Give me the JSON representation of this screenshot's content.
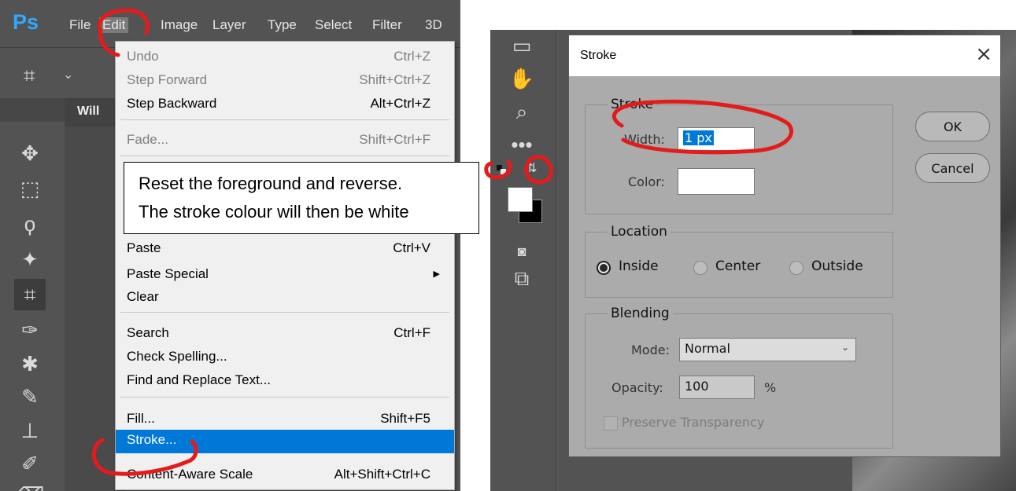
{
  "left_panel": {
    "app_logo": "Ps",
    "menubar": [
      "File",
      "Edit",
      "Image",
      "Layer",
      "Type",
      "Select",
      "Filter",
      "3D"
    ],
    "doc_tab": "Will",
    "edit_menu": {
      "items": [
        {
          "label": "Undo",
          "shortcut": "Ctrl+Z",
          "disabled": true
        },
        {
          "label": "Step Forward",
          "shortcut": "Shift+Ctrl+Z",
          "disabled": true
        },
        {
          "label": "Step Backward",
          "shortcut": "Alt+Ctrl+Z",
          "disabled": false
        },
        {
          "label": "Fade...",
          "shortcut": "Shift+Ctrl+F",
          "disabled": true
        },
        {
          "label": "Paste",
          "shortcut": "Ctrl+V",
          "disabled": false
        },
        {
          "label": "Paste Special",
          "shortcut": "",
          "disabled": false
        },
        {
          "label": "Clear",
          "shortcut": "",
          "disabled": false
        },
        {
          "label": "Search",
          "shortcut": "Ctrl+F",
          "disabled": false
        },
        {
          "label": "Check Spelling...",
          "shortcut": "",
          "disabled": false
        },
        {
          "label": "Find and Replace Text...",
          "shortcut": "",
          "disabled": false
        },
        {
          "label": "Fill...",
          "shortcut": "Shift+F5",
          "disabled": false
        },
        {
          "label": "Stroke...",
          "shortcut": "",
          "disabled": false
        },
        {
          "label": "Content-Aware Scale",
          "shortcut": "Alt+Shift+Ctrl+C",
          "disabled": false
        }
      ]
    },
    "callout": {
      "line1": "Reset the foreground and reverse.",
      "line2": "The stroke colour will then be white"
    }
  },
  "stroke_dialog": {
    "title": "Stroke",
    "close_glyph": "×",
    "stroke_group": {
      "legend": "Stroke",
      "width_label": "Width:",
      "width_value": "1 px",
      "color_label": "Color:",
      "color_value": "#ffffff"
    },
    "location_group": {
      "legend": "Location",
      "options": [
        "Inside",
        "Center",
        "Outside"
      ],
      "selected": "Inside"
    },
    "blending_group": {
      "legend": "Blending",
      "mode_label": "Mode:",
      "mode_value": "Normal",
      "opacity_label": "Opacity:",
      "opacity_value": "100",
      "opacity_unit": "%",
      "preserve_label": "Preserve Transparency"
    },
    "ok_label": "OK",
    "cancel_label": "Cancel"
  },
  "colors": {
    "menu_highlight": "#0078d7",
    "annotation_red": "#e41b1b",
    "ps_dark": "#535353"
  }
}
